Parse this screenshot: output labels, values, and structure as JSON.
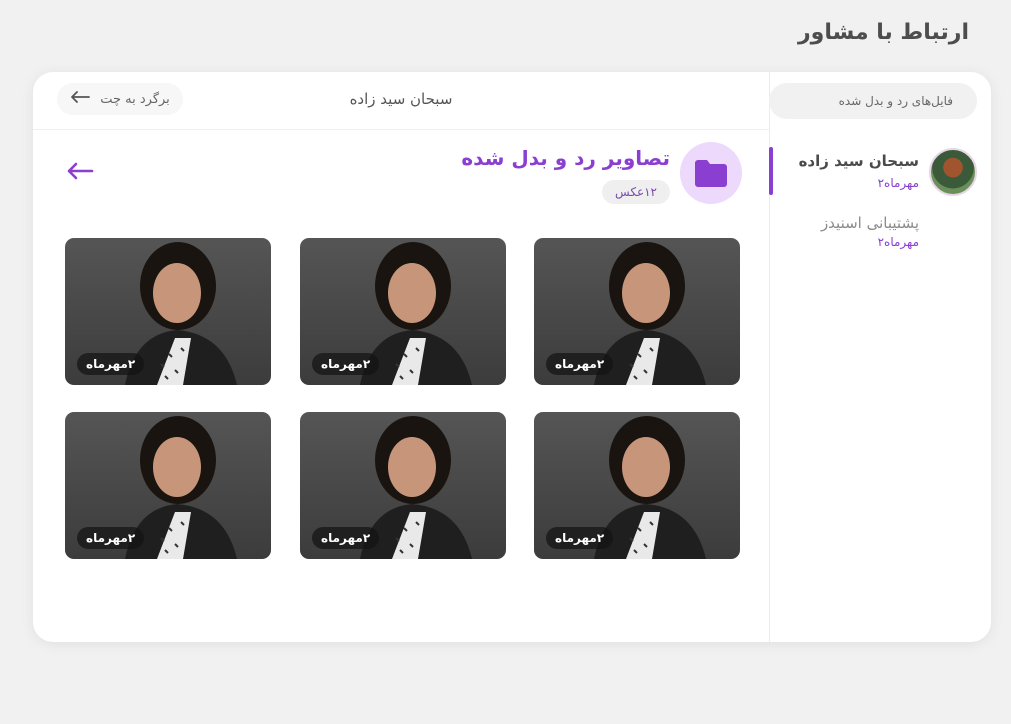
{
  "page": {
    "title": "ارتباط با مشاور"
  },
  "sidebar": {
    "search_placeholder": "فایل‌های رد و بدل شده",
    "contacts": [
      {
        "name": "سبحان سید زاده",
        "date": "مهرماه۲",
        "active": true
      },
      {
        "name": "پشتیبانی اسنیدز",
        "date": "مهرماه۲",
        "active": false
      }
    ]
  },
  "chat": {
    "header_title": "سبحان سید زاده",
    "back_label": "برگرد به چت"
  },
  "folder": {
    "title": "تصاویر رد و بدل شده",
    "count": "۱۲عکس"
  },
  "photos": [
    {
      "date": "۲مهرماه"
    },
    {
      "date": "۲مهرماه"
    },
    {
      "date": "۲مهرماه"
    },
    {
      "date": "۲مهرماه"
    },
    {
      "date": "۲مهرماه"
    },
    {
      "date": "۲مهرماه"
    }
  ],
  "colors": {
    "accent": "#8a3fd1",
    "accent_light": "#ecd9fb"
  },
  "icons": [
    "folder-icon",
    "back-arrow-icon",
    "arrow-left-icon"
  ]
}
